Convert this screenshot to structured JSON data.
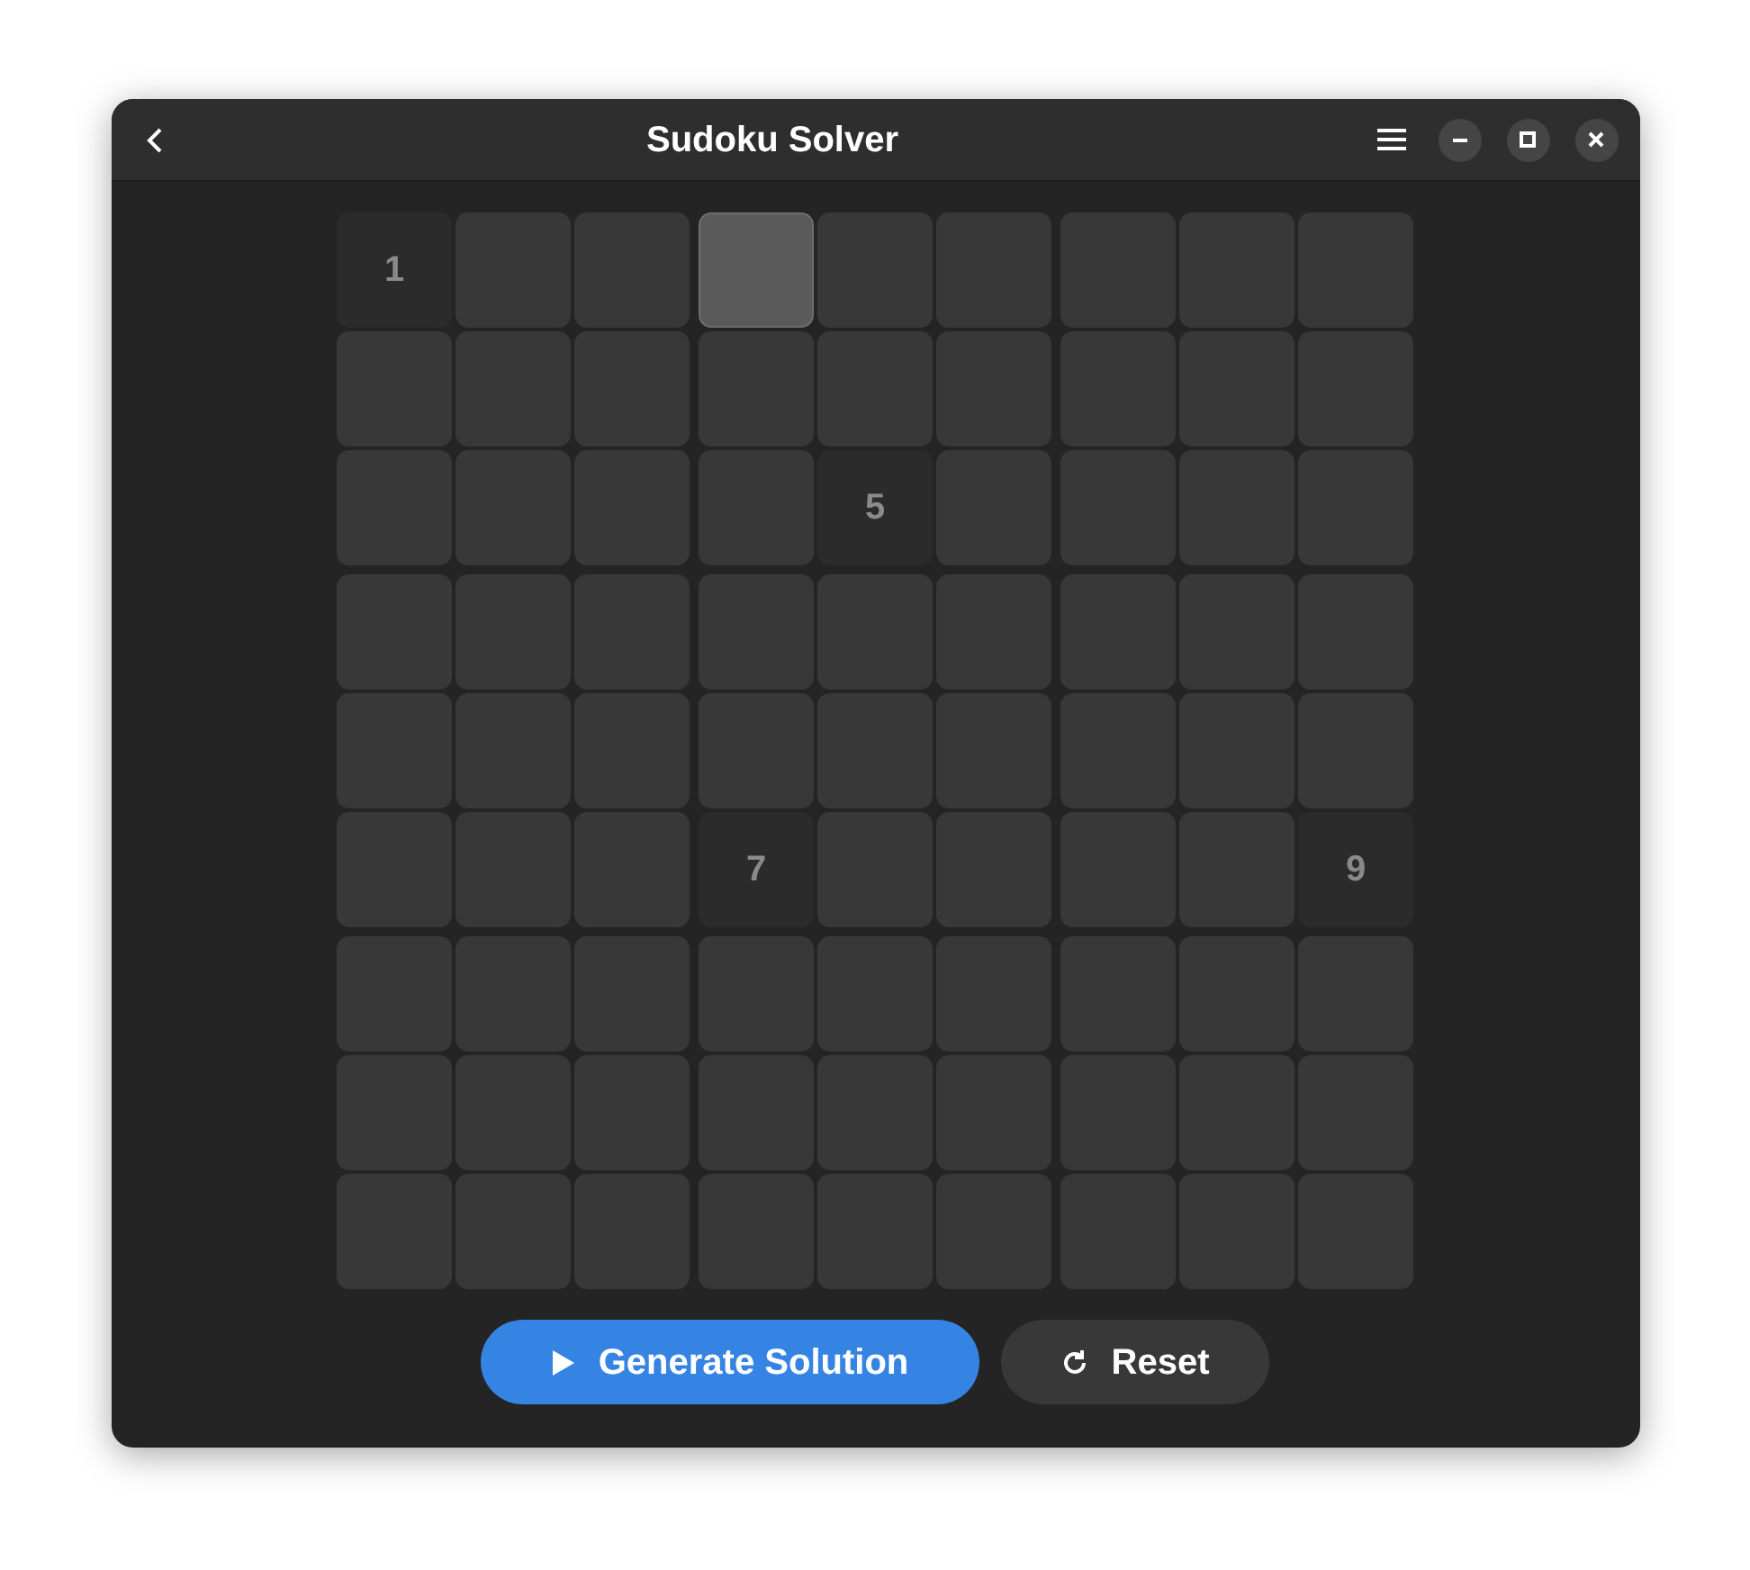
{
  "window": {
    "title": "Sudoku Solver"
  },
  "grid": {
    "rows": [
      [
        {
          "value": "1",
          "selected": false
        },
        {
          "selected": false
        },
        {
          "selected": false
        },
        {
          "selected": true
        },
        {
          "selected": false
        },
        {
          "selected": false
        },
        {
          "selected": false
        },
        {
          "selected": false
        },
        {
          "selected": false
        }
      ],
      [
        {
          "selected": false
        },
        {
          "selected": false
        },
        {
          "selected": false
        },
        {
          "selected": false
        },
        {
          "selected": false
        },
        {
          "selected": false
        },
        {
          "selected": false
        },
        {
          "selected": false
        },
        {
          "selected": false
        }
      ],
      [
        {
          "selected": false
        },
        {
          "selected": false
        },
        {
          "selected": false
        },
        {
          "selected": false
        },
        {
          "value": "5",
          "selected": false
        },
        {
          "selected": false
        },
        {
          "selected": false
        },
        {
          "selected": false
        },
        {
          "selected": false
        }
      ],
      [
        {
          "selected": false
        },
        {
          "selected": false
        },
        {
          "selected": false
        },
        {
          "selected": false
        },
        {
          "selected": false
        },
        {
          "selected": false
        },
        {
          "selected": false
        },
        {
          "selected": false
        },
        {
          "selected": false
        }
      ],
      [
        {
          "selected": false
        },
        {
          "selected": false
        },
        {
          "selected": false
        },
        {
          "selected": false
        },
        {
          "selected": false
        },
        {
          "selected": false
        },
        {
          "selected": false
        },
        {
          "selected": false
        },
        {
          "selected": false
        }
      ],
      [
        {
          "selected": false
        },
        {
          "selected": false
        },
        {
          "selected": false
        },
        {
          "value": "7",
          "selected": false
        },
        {
          "selected": false
        },
        {
          "selected": false
        },
        {
          "selected": false
        },
        {
          "selected": false
        },
        {
          "value": "9",
          "selected": false
        }
      ],
      [
        {
          "selected": false
        },
        {
          "selected": false
        },
        {
          "selected": false
        },
        {
          "selected": false
        },
        {
          "selected": false
        },
        {
          "selected": false
        },
        {
          "selected": false
        },
        {
          "selected": false
        },
        {
          "selected": false
        }
      ],
      [
        {
          "selected": false
        },
        {
          "selected": false
        },
        {
          "selected": false
        },
        {
          "selected": false
        },
        {
          "selected": false
        },
        {
          "selected": false
        },
        {
          "selected": false
        },
        {
          "selected": false
        },
        {
          "selected": false
        }
      ],
      [
        {
          "selected": false
        },
        {
          "selected": false
        },
        {
          "selected": false
        },
        {
          "selected": false
        },
        {
          "selected": false
        },
        {
          "selected": false
        },
        {
          "selected": false
        },
        {
          "selected": false
        },
        {
          "selected": false
        }
      ]
    ]
  },
  "buttons": [
    {
      "kind": "primary",
      "label": "Generate Solution"
    },
    {
      "kind": "secondary",
      "label": "Reset"
    }
  ]
}
